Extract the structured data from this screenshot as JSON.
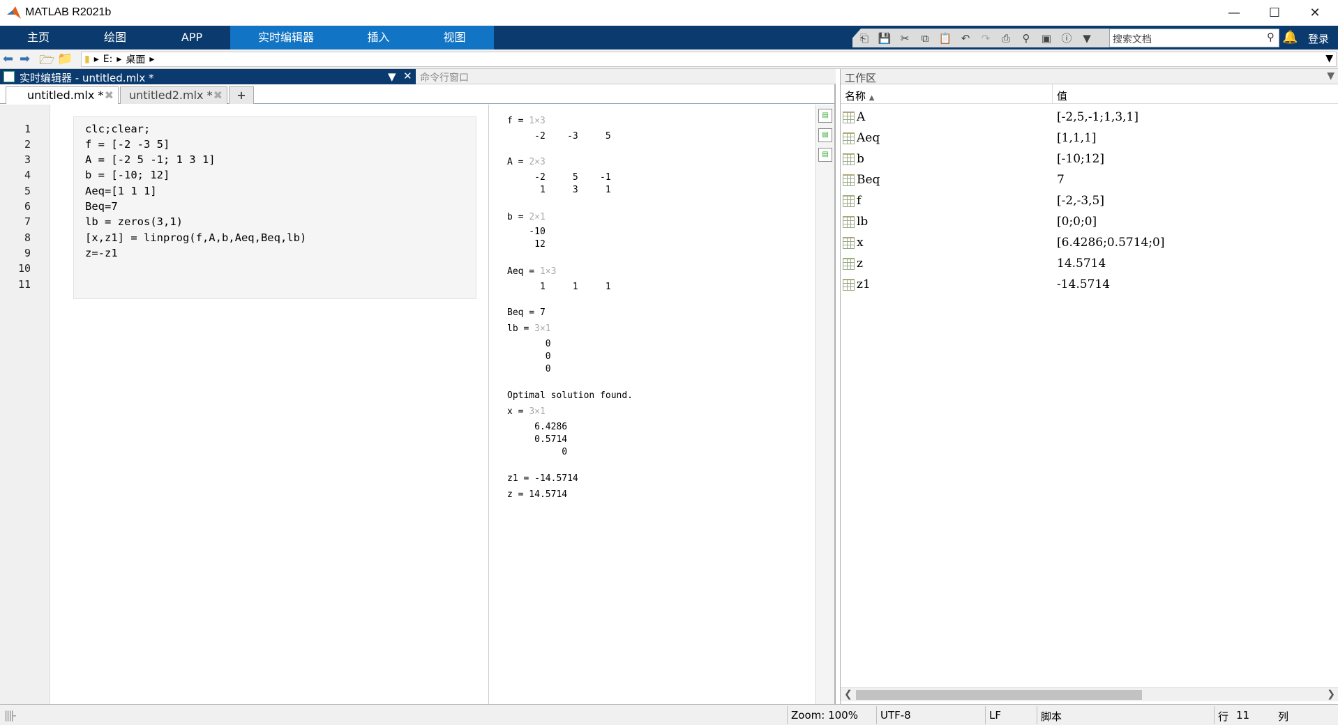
{
  "window": {
    "title": "MATLAB R2021b"
  },
  "ribbon": {
    "tabs": [
      "主页",
      "绘图",
      "APP",
      "实时编辑器",
      "插入",
      "视图"
    ],
    "active_tab": "实时编辑器",
    "search_placeholder": "搜索文档",
    "login": "登录"
  },
  "address": {
    "path": [
      "E:",
      "桌面"
    ]
  },
  "editor": {
    "panel_title": "实时编辑器 - untitled.mlx *",
    "command_window_title": "命令行窗口",
    "tabs": [
      {
        "label": "untitled.mlx *"
      },
      {
        "label": "untitled2.mlx *"
      }
    ],
    "line_numbers": [
      "1",
      "2",
      "3",
      "4",
      "5",
      "6",
      "7",
      "8",
      "9",
      "10",
      "11"
    ],
    "code_lines": [
      "clc;clear;",
      "f = [-2 -3 5]",
      "A = [-2 5 -1; 1 3 1]",
      "b = [-10; 12]",
      "Aeq=[1 1 1]",
      "Beq=7",
      "lb = zeros(3,1)",
      "[x,z1] = linprog(f,A,b,Aeq,Beq,lb)",
      "z=-z1",
      "",
      ""
    ],
    "output": {
      "f": {
        "label": "f = ",
        "size": "1×3",
        "rows": [
          "     -2    -3     5"
        ]
      },
      "A": {
        "label": "A = ",
        "size": "2×3",
        "rows": [
          "     -2     5    -1",
          "      1     3     1"
        ]
      },
      "b": {
        "label": "b = ",
        "size": "2×1",
        "rows": [
          "    -10",
          "     12"
        ]
      },
      "Aeq": {
        "label": "Aeq = ",
        "size": "1×3",
        "rows": [
          "      1     1     1"
        ]
      },
      "Beq": {
        "label": "Beq = 7"
      },
      "lb": {
        "label": "lb = ",
        "size": "3×1",
        "rows": [
          "       0",
          "       0",
          "       0"
        ]
      },
      "msg": "Optimal solution found.",
      "x": {
        "label": "x = ",
        "size": "3×1",
        "rows": [
          "     6.4286",
          "     0.5714",
          "          0"
        ]
      },
      "z1": "z1 = -14.5714",
      "z": "z = 14.5714"
    }
  },
  "workspace": {
    "title": "工作区",
    "col_name": "名称",
    "col_value": "值",
    "vars": [
      {
        "name": "A",
        "value": "[-2,5,-1;1,3,1]"
      },
      {
        "name": "Aeq",
        "value": "[1,1,1]"
      },
      {
        "name": "b",
        "value": "[-10;12]"
      },
      {
        "name": "Beq",
        "value": "7"
      },
      {
        "name": "f",
        "value": "[-2,-3,5]"
      },
      {
        "name": "lb",
        "value": "[0;0;0]"
      },
      {
        "name": "x",
        "value": "[6.4286;0.5714;0]"
      },
      {
        "name": "z",
        "value": "14.5714"
      },
      {
        "name": "z1",
        "value": "-14.5714"
      }
    ]
  },
  "status": {
    "zoom": "Zoom: 100%",
    "encoding": "UTF-8",
    "eol": "LF",
    "type": "脚本",
    "row_label": "行",
    "row": "11",
    "col_label": "列"
  }
}
